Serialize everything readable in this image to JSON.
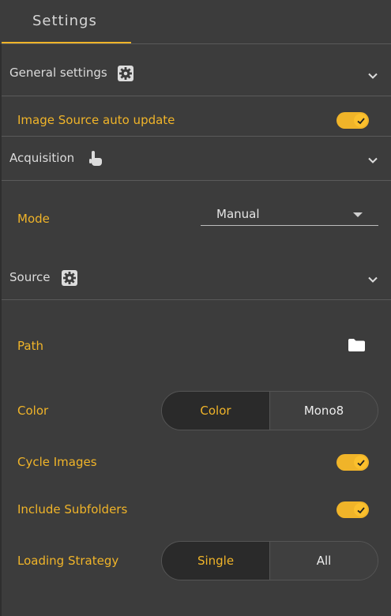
{
  "tab": {
    "label": "Settings"
  },
  "sections": {
    "general": {
      "title": "General settings",
      "icon": "gear-icon"
    },
    "acquisition": {
      "title": "Acquisition",
      "icon": "touch-hand-icon"
    },
    "source": {
      "title": "Source",
      "icon": "gear-icon"
    }
  },
  "general": {
    "image_source_auto_update": {
      "label": "Image Source auto update",
      "checked": true
    }
  },
  "acquisition": {
    "mode": {
      "label": "Mode",
      "value": "Manual"
    }
  },
  "source": {
    "path": {
      "label": "Path",
      "icon": "folder-icon"
    },
    "color": {
      "label": "Color",
      "options": [
        "Color",
        "Mono8"
      ],
      "selected": "Color"
    },
    "cycle_images": {
      "label": "Cycle Images",
      "checked": true
    },
    "include_subfolders": {
      "label": "Include Subfolders",
      "checked": true
    },
    "loading_strategy": {
      "label": "Loading Strategy",
      "options": [
        "Single",
        "All"
      ],
      "selected": "Single"
    }
  },
  "colors": {
    "accent": "#f0b429",
    "background": "#3c3c3c",
    "segment_active": "#2a2a2a"
  }
}
